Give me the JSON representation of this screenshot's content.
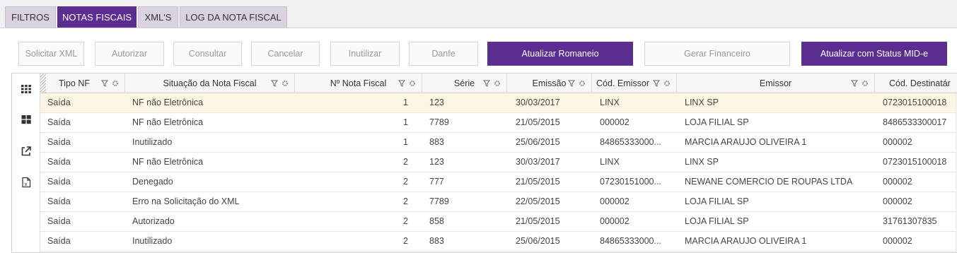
{
  "tabs": [
    {
      "label": "FILTROS"
    },
    {
      "label": "NOTAS FISCAIS"
    },
    {
      "label": "XML'S"
    },
    {
      "label": "LOG DA NOTA FISCAL"
    }
  ],
  "toolbar": {
    "solicitar_xml": "Solicitar XML",
    "autorizar": "Autorizar",
    "consultar": "Consultar",
    "cancelar": "Cancelar",
    "inutilizar": "Inutilizar",
    "danfe": "Danfe",
    "atualizar_romaneio": "Atualizar Romaneio",
    "gerar_financeiro": "Gerar Financeiro",
    "atualizar_status": "Atualizar com Status MID-e"
  },
  "colors": {
    "accent": "#5c2d91",
    "selected_row": "#fdf6e3"
  },
  "sidebar_icons": [
    "grid-icon",
    "tiles-icon",
    "external-link-icon",
    "excel-export-icon"
  ],
  "columns": [
    "Tipo NF",
    "Situação da Nota Fiscal",
    "Nº Nota Fiscal",
    "Série",
    "Emissão",
    "Cód. Emissor",
    "Emissor",
    "Cód. Destinatár"
  ],
  "rows": [
    [
      "Saída",
      "NF não Eletrônica",
      "1",
      "123",
      "30/03/2017",
      "LINX",
      "LINX SP",
      "0723015100018"
    ],
    [
      "Saída",
      "NF não Eletrônica",
      "1",
      "7789",
      "21/05/2015",
      "000002",
      "LOJA FILIAL SP",
      "8486533300017"
    ],
    [
      "Saída",
      "Inutilizado",
      "1",
      "883",
      "25/06/2015",
      "84865333000...",
      "MARCIA ARAUJO OLIVEIRA 1",
      "000002"
    ],
    [
      "Saída",
      "NF não Eletrônica",
      "2",
      "123",
      "30/03/2017",
      "LINX",
      "LINX SP",
      "0723015100018"
    ],
    [
      "Saída",
      "Denegado",
      "2",
      "777",
      "21/05/2015",
      "07230151000...",
      "NEWANE COMERCIO DE ROUPAS LTDA",
      "000002"
    ],
    [
      "Saída",
      "Erro na Solicitação do XML",
      "2",
      "7789",
      "22/05/2015",
      "000002",
      "LOJA FILIAL SP",
      "000002"
    ],
    [
      "Saída",
      "Autorizado",
      "2",
      "858",
      "21/05/2015",
      "000002",
      "LOJA FILIAL SP",
      "31761307835"
    ],
    [
      "Saída",
      "Inutilizado",
      "2",
      "883",
      "25/06/2015",
      "84865333000...",
      "MARCIA ARAUJO OLIVEIRA 1",
      "000002"
    ]
  ]
}
